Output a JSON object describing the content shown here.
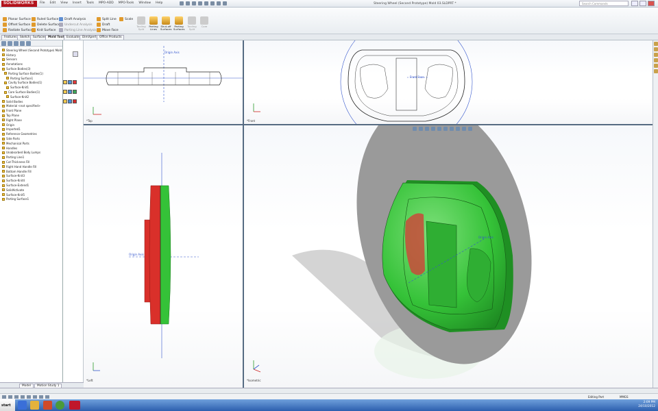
{
  "app": {
    "logo": "SOLIDWORKS",
    "window_title": "Steering Wheel (Second Prototype) Mold 03.SLDPRT *",
    "search_placeholder": "Search Commands"
  },
  "menu": [
    "File",
    "Edit",
    "View",
    "Insert",
    "Tools",
    "MPO-ADD",
    "MPO-Tools",
    "Window",
    "Help"
  ],
  "commands": {
    "row1": [
      "Planar Surface",
      "Ruled Surface",
      "Draft Analysis",
      "Split Line",
      "Scale"
    ],
    "row2": [
      "Offset Surface",
      "Delete Surface",
      "Undercut Analysis",
      "Draft"
    ],
    "row3": [
      "Radiate Surface",
      "Knit Surface",
      "Parting Line Analysis",
      "Move Face"
    ],
    "big": [
      "Tooling Split",
      "Parting Lines",
      "Shut-off Surfaces",
      "Parting Surfaces",
      "Tooling Split",
      "Core"
    ]
  },
  "tabs": [
    "Features",
    "Sketch",
    "Surfaces",
    "Mold Tools",
    "Evaluate",
    "DimXpert",
    "Office Products"
  ],
  "active_tab": "Mold Tools",
  "tree": [
    "Steering Wheel (Second Prototype) Mold 03",
    "History",
    "Sensors",
    "Annotations",
    "Surface Bodies(3)",
    "Parting Surface Bodies(1)",
    "Parting Surface1",
    "Cavity Surface Bodies(1)",
    "Surface-Knit1",
    "Core Surface Bodies(1)",
    "Surface-Knit2",
    "Solid Bodies",
    "Material <not specified>",
    "Front Plane",
    "Top Plane",
    "Right Plane",
    "Origin",
    "Imported1",
    "Reference Geometries",
    "Side Parts",
    "Mechanical Parts",
    "Handles",
    "Unabsorbed Body Lumps",
    "Parting Line1",
    "Cut-Thickness Fill",
    "Right Hand Handle Fill",
    "Bottom Handle Fill",
    "Surface-Knit3",
    "Surface-Knit4",
    "Surface-Extend1",
    "SolidActivate",
    "Surface-Knit5",
    "Parting Surface1"
  ],
  "swatch_colors": [
    [
      "#f2c94c",
      "#4a8fd8",
      "#e0383a"
    ],
    [
      "#f2c94c",
      "#4a8fd8",
      "#3ca65b"
    ],
    [
      "#f2c94c",
      "#4a8fd8",
      "#d33030"
    ]
  ],
  "viewports": {
    "top_left": {
      "label": "*Top",
      "axis": "Origin Axis"
    },
    "top_right": {
      "label": "*Front",
      "axis": "Front Face"
    },
    "bottom_left": {
      "label": "*Left",
      "axis": "Origin Axis"
    },
    "bottom_right": {
      "label": "*Isometric",
      "axis": "Origin Axis"
    }
  },
  "fm_tabs": [
    "Model",
    "Motion Study 1"
  ],
  "status": {
    "editing": "Editing Part",
    "units": "MMGS"
  },
  "taskbar": {
    "start": "start",
    "time": "2:09 PM",
    "date": "24/10/2012"
  },
  "colors": {
    "core": "#35c238",
    "cavity": "#d9302a",
    "brand": "#b3121b",
    "disk": "#9a9a9a"
  }
}
